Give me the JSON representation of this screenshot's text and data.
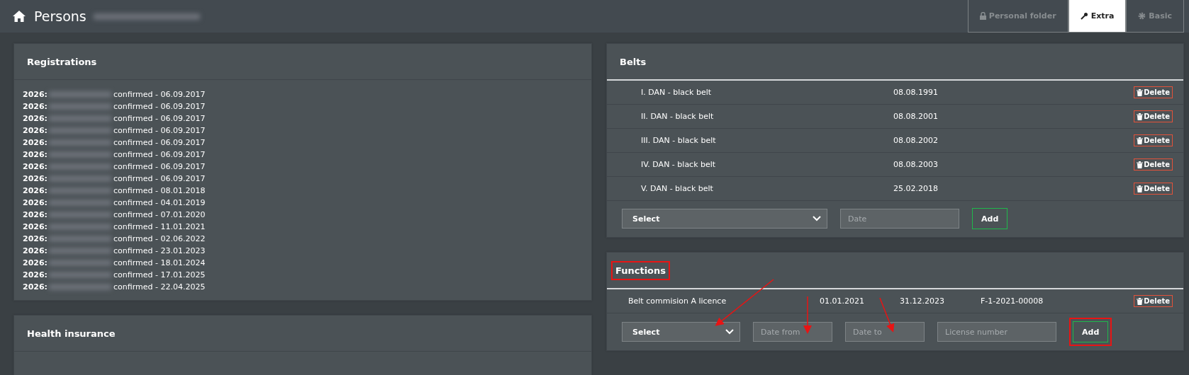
{
  "header": {
    "title": "Persons",
    "tabs": [
      {
        "label": "Personal folder",
        "selected": false
      },
      {
        "label": "Extra",
        "selected": true
      },
      {
        "label": "Basic",
        "selected": false
      }
    ]
  },
  "registrations": {
    "title": "Registrations",
    "items": [
      {
        "year": "2026:",
        "status": "confirmed - 06.09.2017"
      },
      {
        "year": "2026:",
        "status": "confirmed - 06.09.2017"
      },
      {
        "year": "2026:",
        "status": "confirmed - 06.09.2017"
      },
      {
        "year": "2026:",
        "status": "confirmed - 06.09.2017"
      },
      {
        "year": "2026:",
        "status": "confirmed - 06.09.2017"
      },
      {
        "year": "2026:",
        "status": "confirmed - 06.09.2017"
      },
      {
        "year": "2026:",
        "status": "confirmed - 06.09.2017"
      },
      {
        "year": "2026:",
        "status": "confirmed - 06.09.2017"
      },
      {
        "year": "2026:",
        "status": "confirmed - 08.01.2018"
      },
      {
        "year": "2026:",
        "status": "confirmed - 04.01.2019"
      },
      {
        "year": "2026:",
        "status": "confirmed - 07.01.2020"
      },
      {
        "year": "2026:",
        "status": "confirmed - 11.01.2021"
      },
      {
        "year": "2026:",
        "status": "confirmed - 02.06.2022"
      },
      {
        "year": "2026:",
        "status": "confirmed - 23.01.2023"
      },
      {
        "year": "2026:",
        "status": "confirmed - 18.01.2024"
      },
      {
        "year": "2026:",
        "status": "confirmed - 17.01.2025"
      },
      {
        "year": "2026:",
        "status": "confirmed - 22.04.2025"
      }
    ]
  },
  "health_insurance": {
    "title": "Health insurance"
  },
  "belts": {
    "title": "Belts",
    "rows": [
      {
        "name": "I. DAN - black belt",
        "date": "08.08.1991",
        "action": "Delete"
      },
      {
        "name": "II. DAN - black belt",
        "date": "08.08.2001",
        "action": "Delete"
      },
      {
        "name": "III. DAN - black belt",
        "date": "08.08.2002",
        "action": "Delete"
      },
      {
        "name": "IV. DAN - black belt",
        "date": "08.08.2003",
        "action": "Delete"
      },
      {
        "name": "V. DAN - black belt",
        "date": "25.02.2018",
        "action": "Delete"
      }
    ],
    "form": {
      "select": "Select",
      "date_placeholder": "Date",
      "button": "Add"
    }
  },
  "functions": {
    "title": "Functions",
    "title_highlighted": true,
    "rows": [
      {
        "name": "Belt commision A licence",
        "date_from": "01.01.2021",
        "date_to": "31.12.2023",
        "license": "F-1-2021-00008",
        "action": "Delete"
      }
    ],
    "form": {
      "select": "Select",
      "fields": [
        {
          "placeholder": "Date from"
        },
        {
          "placeholder": "Date to"
        },
        {
          "placeholder": "License number"
        }
      ],
      "button": "Add",
      "button_highlighted": true
    }
  }
}
